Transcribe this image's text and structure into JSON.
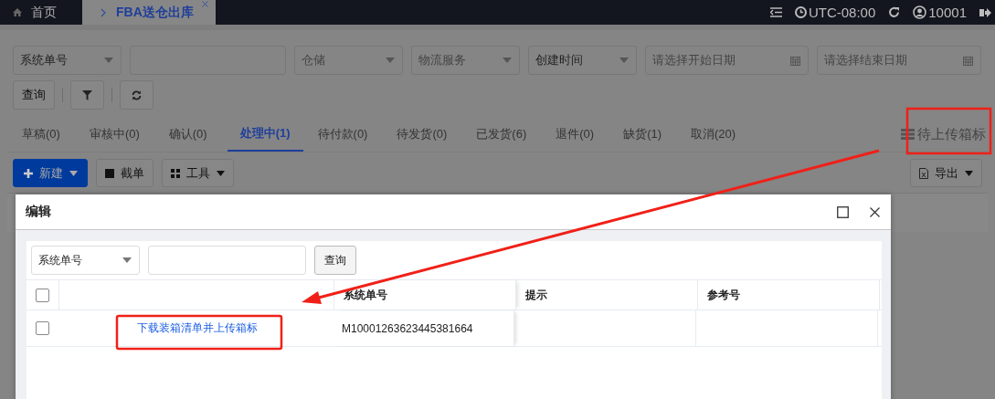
{
  "topbar": {
    "tabs": [
      {
        "label": "首页",
        "selected": false
      },
      {
        "label": "FBA送仓出库",
        "selected": true
      }
    ],
    "timezone": "UTC-08:00",
    "user": "10001"
  },
  "filters": [
    {
      "kind": "select",
      "value": "系统单号"
    },
    {
      "kind": "input"
    },
    {
      "kind": "select",
      "placeholder": "仓储"
    },
    {
      "kind": "select",
      "placeholder": "物流服务"
    },
    {
      "kind": "select",
      "value": "创建时间"
    },
    {
      "kind": "date",
      "placeholder": "请选择开始日期"
    },
    {
      "kind": "date",
      "placeholder": "请选择结束日期"
    }
  ],
  "search_button": "查询",
  "status_tabs": [
    {
      "label": "草稿(0)",
      "selected": false
    },
    {
      "label": "审核中(0)",
      "selected": false
    },
    {
      "label": "确认(0)",
      "selected": false
    },
    {
      "label": "处理中(1)",
      "selected": true
    },
    {
      "label": "待付款(0)",
      "selected": false
    },
    {
      "label": "待发货(0)",
      "selected": false
    },
    {
      "label": "已发货(6)",
      "selected": false
    },
    {
      "label": "退件(0)",
      "selected": false
    },
    {
      "label": "缺货(1)",
      "selected": false
    },
    {
      "label": "取消(20)",
      "selected": false
    }
  ],
  "pending_label_link": "待上传箱标",
  "toolbar": [
    {
      "label": "新建",
      "kind": "primary"
    },
    {
      "label": "截单",
      "kind": "plain"
    },
    {
      "label": "工具",
      "kind": "menu"
    }
  ],
  "export_button": "导出",
  "dialog": {
    "title": "编辑",
    "search_select": "系统单号",
    "search_button": "查询",
    "columns": [
      "系统单号",
      "提示",
      "参考号"
    ],
    "header_checked": false,
    "rows": [
      {
        "checked": false,
        "action": "下载装箱清单并上传箱标",
        "order_no": "M10001263623445381664"
      }
    ]
  }
}
